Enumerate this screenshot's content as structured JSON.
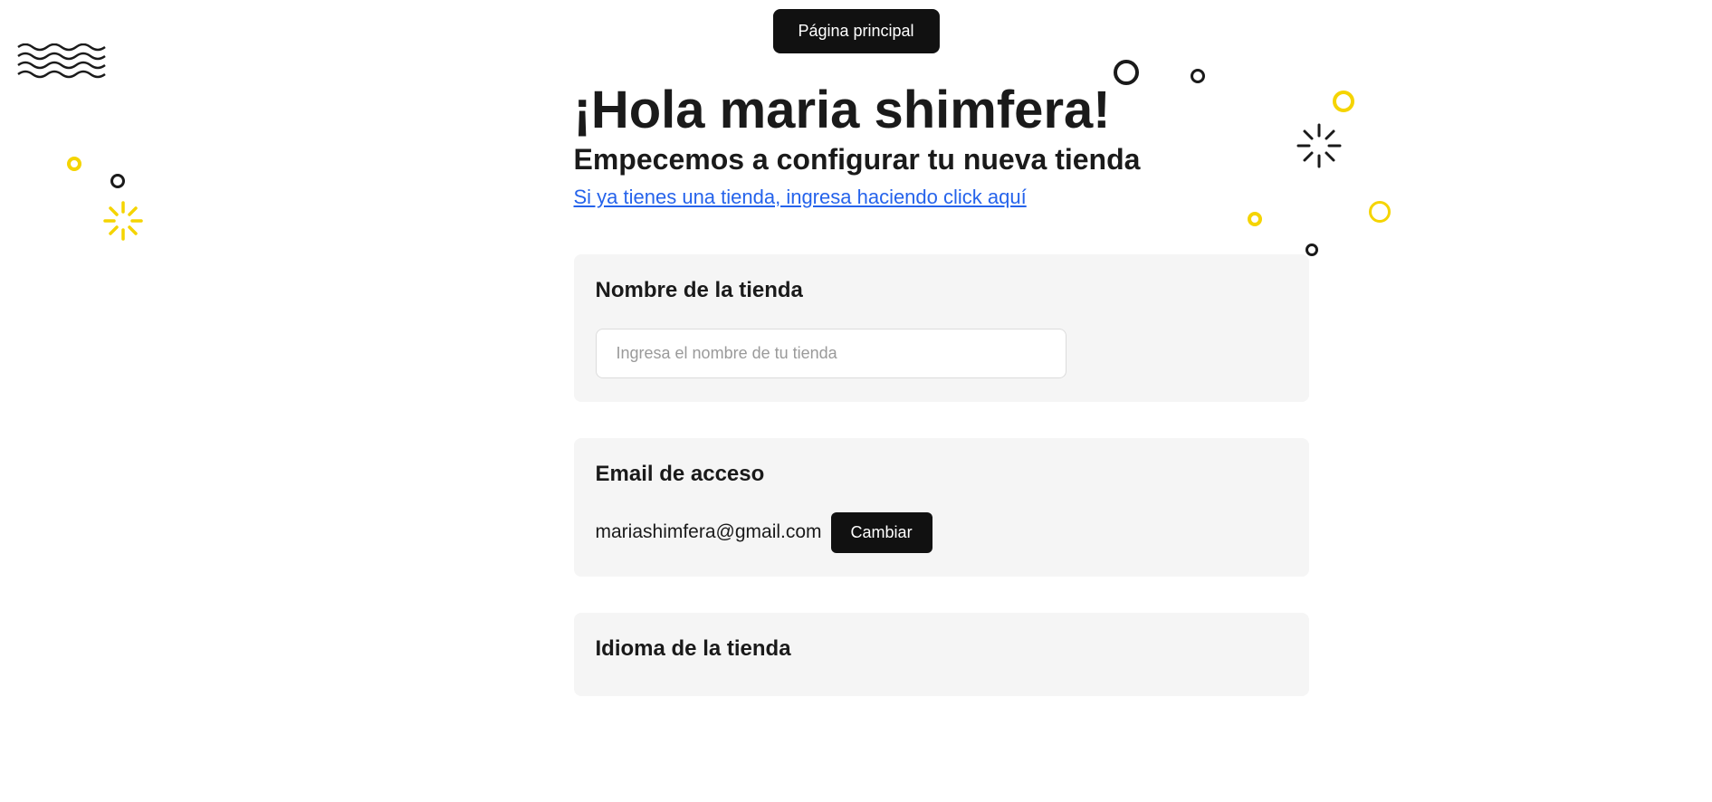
{
  "header": {
    "main_page_button": "Página principal"
  },
  "hero": {
    "title": "¡Hola maria shimfera!",
    "subtitle": "Empecemos a configurar tu nueva tienda",
    "login_link": "Si ya tienes una tienda, ingresa haciendo click aquí"
  },
  "store_name": {
    "label": "Nombre de la tienda",
    "placeholder": "Ingresa el nombre de tu tienda",
    "value": ""
  },
  "email": {
    "label": "Email de acceso",
    "value": "mariashimfera@gmail.com",
    "change_button": "Cambiar"
  },
  "language": {
    "label": "Idioma de la tienda"
  }
}
